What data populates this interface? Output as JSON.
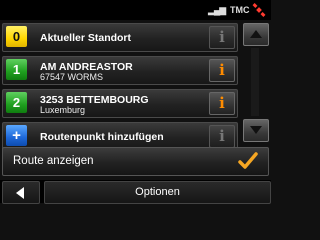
{
  "status": {
    "signal_icon": "signal-bars-icon",
    "tmc_label": "TMC",
    "gps_icon": "gps-satellite-icon"
  },
  "route_points": [
    {
      "badge": "0",
      "badge_color": "#ffd700",
      "title": "Aktueller Standort",
      "subtitle": "",
      "info_state": "inactive"
    },
    {
      "badge": "1",
      "badge_color": "#1fa01f",
      "title": "AM ANDREASTOR",
      "subtitle": "67547 WORMS",
      "info_state": "active"
    },
    {
      "badge": "2",
      "badge_color": "#1fa01f",
      "title": "3253 BETTEMBOURG",
      "subtitle": "Luxemburg",
      "info_state": "active"
    },
    {
      "badge": "+",
      "badge_color": "#1e68d8",
      "title": "Routenpunkt hinzufügen",
      "subtitle": "",
      "info_state": "inactive"
    }
  ],
  "info_glyph": "i",
  "route_button": {
    "label": "Route anzeigen",
    "icon": "checkmark-icon",
    "icon_color": "#f5a623"
  },
  "bottom": {
    "back_icon": "back-arrow-icon",
    "options_label": "Optionen"
  }
}
